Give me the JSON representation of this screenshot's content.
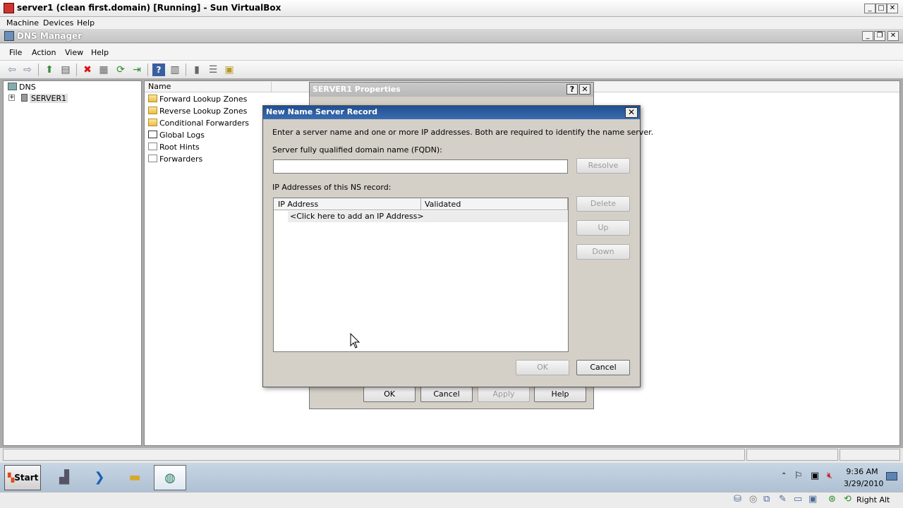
{
  "host": {
    "title": "server1 (clean first.domain) [Running] - Sun VirtualBox",
    "menu": [
      "Machine",
      "Devices",
      "Help"
    ],
    "status_right": "Right Alt"
  },
  "app": {
    "title": "DNS Manager",
    "menu": [
      "File",
      "Action",
      "View",
      "Help"
    ]
  },
  "tree": {
    "root": "DNS",
    "server": "SERVER1",
    "expander": "+"
  },
  "list": {
    "column_name": "Name",
    "items": [
      {
        "label": "Forward Lookup Zones",
        "icon": "folder-icon"
      },
      {
        "label": "Reverse Lookup Zones",
        "icon": "folder-icon"
      },
      {
        "label": "Conditional Forwarders",
        "icon": "folder-icon"
      },
      {
        "label": "Global Logs",
        "icon": "log-icon"
      },
      {
        "label": "Root Hints",
        "icon": "document-icon"
      },
      {
        "label": "Forwarders",
        "icon": "document-icon"
      }
    ]
  },
  "properties_dialog": {
    "title": "SERVER1 Properties",
    "help_glyph": "?",
    "close_glyph": "✕",
    "ok": "OK",
    "cancel": "Cancel",
    "apply": "Apply",
    "help": "Help"
  },
  "ns_dialog": {
    "title": "New Name Server Record",
    "close_glyph": "✕",
    "instruction": "Enter a server name and one or more IP addresses.  Both are required to identify the name server.",
    "fqdn_label": "Server fully qualified domain name (FQDN):",
    "fqdn_value": "",
    "resolve": "Resolve",
    "ip_label": "IP Addresses of this NS record:",
    "col_ip": "IP Address",
    "col_validated": "Validated",
    "add_row": "<Click here to add an IP Address>",
    "delete": "Delete",
    "up": "Up",
    "down": "Down",
    "ok": "OK",
    "cancel": "Cancel"
  },
  "taskbar": {
    "start": "Start",
    "time": "9:36 AM",
    "date": "3/29/2010"
  },
  "colors": {
    "dialog_title": "#2a5ca0",
    "window_face": "#d4d0c8"
  }
}
